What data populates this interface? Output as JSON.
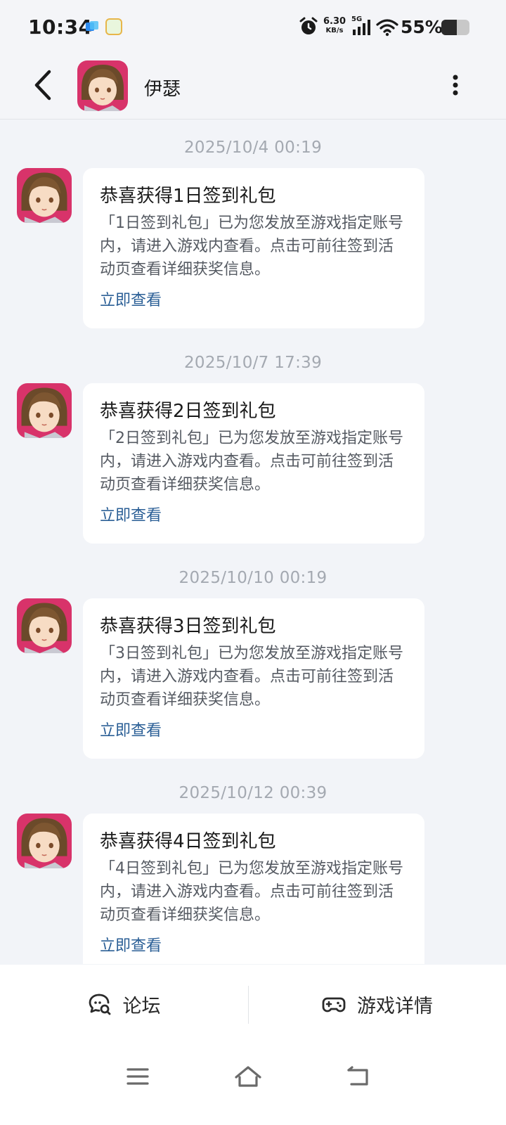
{
  "status_bar": {
    "time": "10:34",
    "net_speed_value": "6.30",
    "net_speed_unit": "KB/s",
    "network_type": "5G",
    "battery_percent_text": "55%",
    "battery_level": 0.55
  },
  "header": {
    "title": "伊瑟",
    "avatar_icon": "game-character-avatar"
  },
  "messages": [
    {
      "time": "2025/10/4  00:19",
      "title": "恭喜获得1日签到礼包",
      "body": "「1日签到礼包」已为您发放至游戏指定账号内，请进入游戏内查看。点击可前往签到活动页查看详细获奖信息。",
      "link": "立即查看"
    },
    {
      "time": "2025/10/7  17:39",
      "title": "恭喜获得2日签到礼包",
      "body": "「2日签到礼包」已为您发放至游戏指定账号内，请进入游戏内查看。点击可前往签到活动页查看详细获奖信息。",
      "link": "立即查看"
    },
    {
      "time": "2025/10/10  00:19",
      "title": "恭喜获得3日签到礼包",
      "body": "「3日签到礼包」已为您发放至游戏指定账号内，请进入游戏内查看。点击可前往签到活动页查看详细获奖信息。",
      "link": "立即查看"
    },
    {
      "time": "2025/10/12  00:39",
      "title": "恭喜获得4日签到礼包",
      "body": "「4日签到礼包」已为您发放至游戏指定账号内，请进入游戏内查看。点击可前往签到活动页查看详细获奖信息。",
      "link": "立即查看"
    }
  ],
  "bottom_bar": {
    "forum_label": "论坛",
    "game_details_label": "游戏详情"
  },
  "colors": {
    "link": "#2b5f96",
    "background": "#f2f4f8",
    "card": "#ffffff",
    "timestamp": "#a4a9b1"
  }
}
